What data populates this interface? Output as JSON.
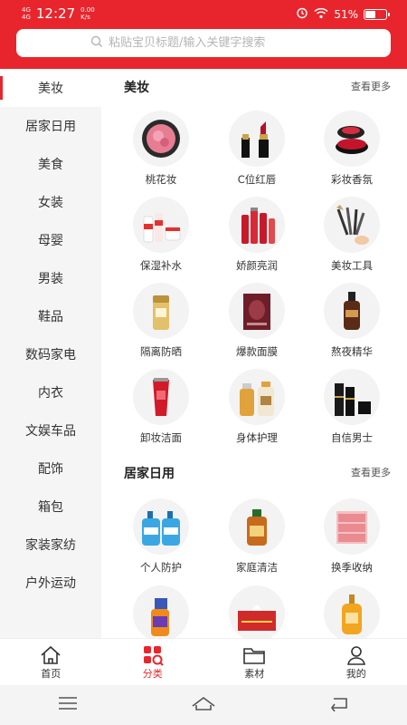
{
  "status_bar": {
    "carrier_line1": "4G",
    "carrier_line2": "4G",
    "time": "12:27",
    "speed_value": "0.00",
    "speed_unit": "K/s",
    "battery": "51%",
    "battery_fraction": 0.51
  },
  "search": {
    "placeholder": "粘贴宝贝标题/输入关键字搜索"
  },
  "sidebar": {
    "items": [
      {
        "label": "美妆"
      },
      {
        "label": "居家日用"
      },
      {
        "label": "美食"
      },
      {
        "label": "女装"
      },
      {
        "label": "母婴"
      },
      {
        "label": "男装"
      },
      {
        "label": "鞋品"
      },
      {
        "label": "数码家电"
      },
      {
        "label": "内衣"
      },
      {
        "label": "文娱车品"
      },
      {
        "label": "配饰"
      },
      {
        "label": "箱包"
      },
      {
        "label": "家装家纺"
      },
      {
        "label": "户外运动"
      }
    ]
  },
  "sections": [
    {
      "title": "美妆",
      "more": "查看更多",
      "items": [
        {
          "label": "桃花妆",
          "icon": "compact-blush-icon"
        },
        {
          "label": "C位红唇",
          "icon": "lipstick-icon"
        },
        {
          "label": "彩妆香氛",
          "icon": "cushion-puff-icon"
        },
        {
          "label": "保湿补水",
          "icon": "skincare-bottles-icon"
        },
        {
          "label": "娇颜亮润",
          "icon": "red-serum-bottles-icon"
        },
        {
          "label": "美妆工具",
          "icon": "makeup-brushes-icon"
        },
        {
          "label": "隔离防晒",
          "icon": "sunscreen-bottle-icon"
        },
        {
          "label": "爆款面膜",
          "icon": "face-mask-icon"
        },
        {
          "label": "熬夜精华",
          "icon": "serum-dropper-icon"
        },
        {
          "label": "卸妆洁面",
          "icon": "cleanser-tube-icon"
        },
        {
          "label": "身体护理",
          "icon": "body-lotion-icon"
        },
        {
          "label": "自信男士",
          "icon": "mens-skincare-icon"
        }
      ]
    },
    {
      "title": "居家日用",
      "more": "查看更多",
      "items": [
        {
          "label": "个人防护",
          "icon": "hand-soap-icon"
        },
        {
          "label": "家庭清洁",
          "icon": "disinfectant-bottle-icon"
        },
        {
          "label": "换季收纳",
          "icon": "storage-drawers-icon"
        },
        {
          "label": "",
          "icon": "spray-cleaner-icon"
        },
        {
          "label": "",
          "icon": "tissue-box-icon"
        },
        {
          "label": "",
          "icon": "shampoo-bottle-icon"
        }
      ]
    }
  ],
  "bottom_nav": [
    {
      "label": "首页",
      "icon": "home-icon"
    },
    {
      "label": "分类",
      "icon": "category-icon"
    },
    {
      "label": "素材",
      "icon": "folder-icon"
    },
    {
      "label": "我的",
      "icon": "user-icon"
    }
  ],
  "colors": {
    "brand": "#e8252c",
    "sidebar_bg": "#f5f5f5"
  }
}
